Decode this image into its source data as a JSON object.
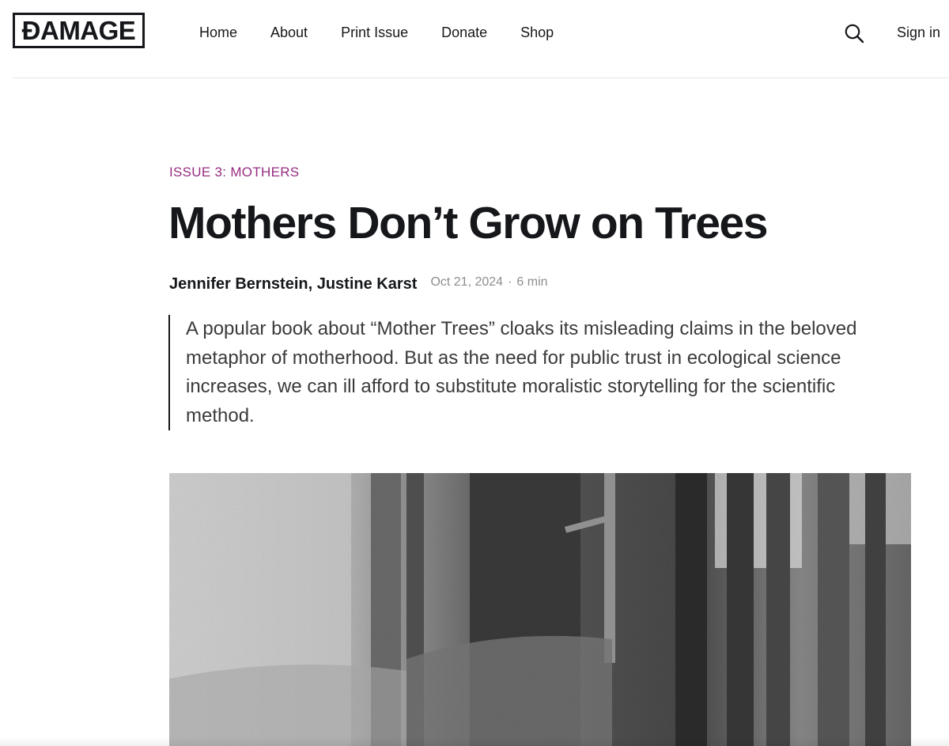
{
  "brand": {
    "logo_text": "ÐAMAGE"
  },
  "nav": {
    "items": [
      {
        "label": "Home"
      },
      {
        "label": "About"
      },
      {
        "label": "Print Issue"
      },
      {
        "label": "Donate"
      },
      {
        "label": "Shop"
      }
    ],
    "search_icon": "search-icon",
    "signin_label": "Sign in"
  },
  "article": {
    "tag": "ISSUE 3: MOTHERS",
    "title": "Mothers Don’t Grow on Trees",
    "authors": "Jennifer Bernstein, Justine Karst",
    "date": "Oct 21, 2024",
    "separator": "·",
    "read_time": "6 min",
    "excerpt": "A popular book about “Mother Trees” cloaks its misleading claims in the beloved metaphor of motherhood. But as the need for public trust in ecological science increases, we can ill afford to substitute moralistic storytelling for the scientific method."
  },
  "colors": {
    "accent": "#962d82",
    "text": "#15171a",
    "muted": "#8e8e8e"
  }
}
